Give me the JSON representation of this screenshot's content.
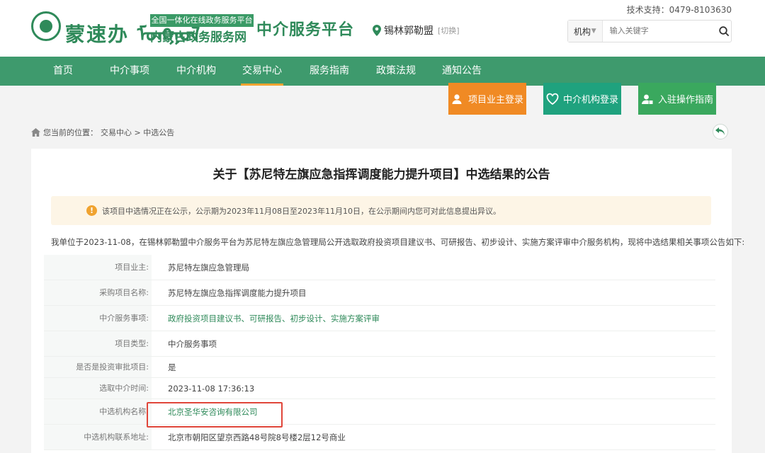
{
  "header": {
    "logo_script": "蒙速办 ᠮᠣᠩᠭᠣᠯ",
    "logo_badge": "全国一体化在线政务服务平台",
    "logo_name": "内蒙古政务服务网",
    "site_title": "中介服务平台",
    "region": "锡林郭勒盟",
    "region_switch": "[切换]",
    "support": "技术支持：0479-8103630",
    "search": {
      "scope": "机构",
      "placeholder": "输入关键字"
    }
  },
  "nav": {
    "items": [
      {
        "label": "首页"
      },
      {
        "label": "中介事项"
      },
      {
        "label": "中介机构"
      },
      {
        "label": "交易中心",
        "active": true
      },
      {
        "label": "服务指南"
      },
      {
        "label": "政策法规"
      },
      {
        "label": "通知公告"
      }
    ]
  },
  "actions": [
    {
      "label": "项目业主登录",
      "color": "#f08a24"
    },
    {
      "label": "中介机构登录",
      "color": "#1fa27e"
    },
    {
      "label": "入驻操作指南",
      "color": "#3aa85e"
    }
  ],
  "breadcrumb": {
    "prefix": "您当前的位置：",
    "path": "交易中心 > 中选公告"
  },
  "article": {
    "title": "关于【苏尼特左旗应急指挥调度能力提升项目】中选结果的公告",
    "notice": "该项目中选情况正在公示，公示期为2023年11月08日至2023年11月10日，在公示期间内您可对此信息提出异议。",
    "intro": "我单位于2023-11-08，在锡林郭勒盟中介服务平台为苏尼特左旗应急管理局公开选取政府投资项目建议书、可研报告、初步设计、实施方案评审中介服务机构，现将中选结果相关事项公告如下:",
    "rows": [
      {
        "label": "项目业主:",
        "value": "苏尼特左旗应急管理局"
      },
      {
        "label": "采购项目名称:",
        "value": "苏尼特左旗应急指挥调度能力提升项目"
      },
      {
        "label": "中介服务事项:",
        "value": "政府投资项目建议书、可研报告、初步设计、实施方案评审"
      },
      {
        "label": "项目类型:",
        "value": "中介服务事项"
      },
      {
        "label": "是否是投资审批项目:",
        "value": "是"
      },
      {
        "label": "选取中介时间:",
        "value": "2023-11-08 17:36:13"
      },
      {
        "label": "中选机构名称:",
        "value": "北京圣华安咨询有限公司"
      },
      {
        "label": "中选机构联系地址:",
        "value": "北京市朝阳区望京西路48号院8号楼2层12号商业"
      }
    ]
  },
  "colors": {
    "brand": "#2f8a5a",
    "nav": "#3e9a6d",
    "accent": "#f0a330",
    "highlight": "#e0463a"
  }
}
